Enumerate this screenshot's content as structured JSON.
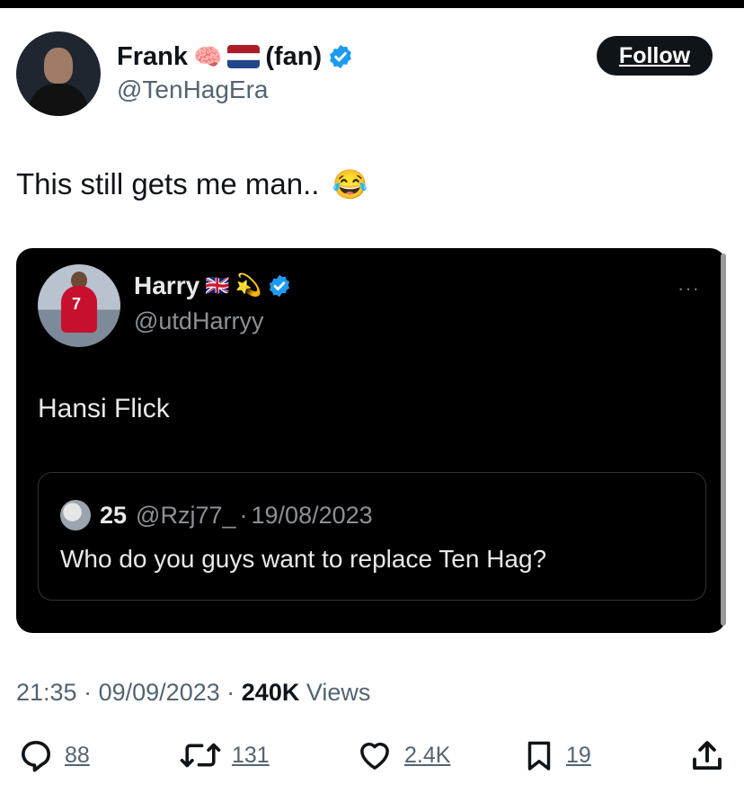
{
  "author": {
    "display_name": "Frank",
    "name_suffix": "(fan)",
    "brain_emoji": "🧠",
    "flag": "netherlands",
    "verified": true,
    "handle": "@TenHagEra"
  },
  "follow_label": "Follow",
  "tweet": {
    "text": "This still gets me man..",
    "emoji": "😂"
  },
  "embedded_tweet": {
    "display_name": "Harry",
    "flag_emoji": "🇬🇧",
    "extra_emoji": "💫",
    "handle": "@utdHarryy",
    "more": "···",
    "text": "Hansi Flick",
    "avatar_number": "7",
    "quote": {
      "name": "25",
      "handle": "@Rzj77_",
      "separator": "·",
      "date": "19/08/2023",
      "text": "Who do you guys want to replace Ten Hag?"
    }
  },
  "meta": {
    "time": "21:35",
    "separator": "·",
    "date": "09/09/2023",
    "views_count": "240K",
    "views_label": "Views"
  },
  "actions": {
    "replies": "88",
    "retweets": "131",
    "likes": "2.4K",
    "bookmarks": "19"
  },
  "colors": {
    "verified_blue": "#1d9bf0",
    "text_primary": "#0f1419",
    "text_secondary": "#536471",
    "embed_bg": "#000000"
  }
}
